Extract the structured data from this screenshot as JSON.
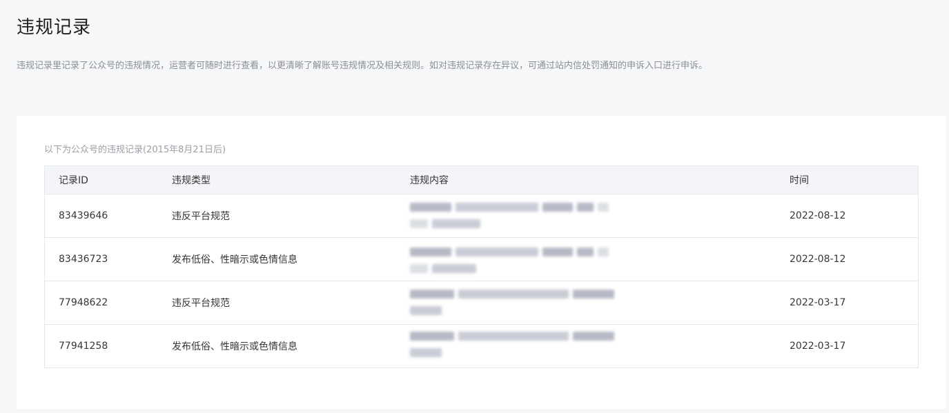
{
  "page": {
    "title": "违规记录",
    "description": "违规记录里记录了公众号的违规情况，运营者可随时进行查看，以更清晰了解账号违规情况及相关规则。如对违规记录存在异议，可通过站内信处罚通知的申诉入口进行申诉。"
  },
  "card": {
    "note": "以下为公众号的违规记录(2015年8月21日后)"
  },
  "table": {
    "headers": {
      "id": "记录ID",
      "type": "违规类型",
      "content": "违规内容",
      "time": "时间"
    },
    "rows": [
      {
        "id": "83439646",
        "type": "违反平台规范",
        "time": "2022-08-12"
      },
      {
        "id": "83436723",
        "type": "发布低俗、性暗示或色情信息",
        "time": "2022-08-12"
      },
      {
        "id": "77948622",
        "type": "违反平台规范",
        "time": "2022-03-17"
      },
      {
        "id": "77941258",
        "type": "发布低俗、性暗示或色情信息",
        "time": "2022-03-17"
      }
    ]
  },
  "colors": {
    "page_background": "#f6f7f9",
    "card_background": "#ffffff",
    "table_header_background": "#f4f5f9",
    "border": "#e4e8eb",
    "muted_text": "#8a8e96"
  }
}
